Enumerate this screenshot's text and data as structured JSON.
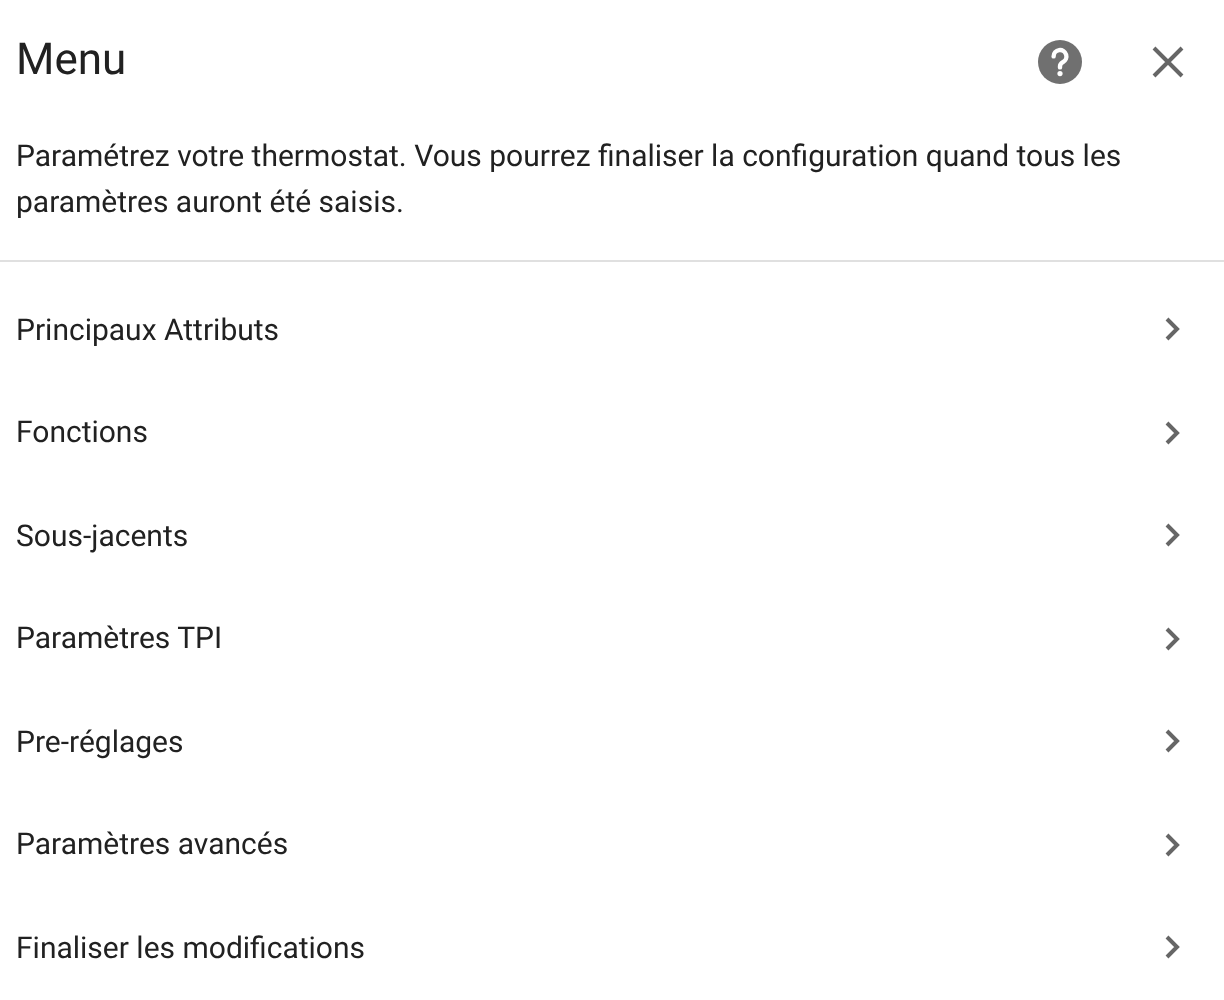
{
  "dialog": {
    "title": "Menu",
    "description": "Paramétrez votre thermostat. Vous pourrez finaliser la configuration quand tous les paramètres auront été saisis."
  },
  "items": [
    {
      "label": "Principaux Attributs"
    },
    {
      "label": "Fonctions"
    },
    {
      "label": "Sous-jacents"
    },
    {
      "label": "Paramètres TPI"
    },
    {
      "label": "Pre-réglages"
    },
    {
      "label": "Paramètres avancés"
    },
    {
      "label": "Finaliser les modifications"
    }
  ]
}
